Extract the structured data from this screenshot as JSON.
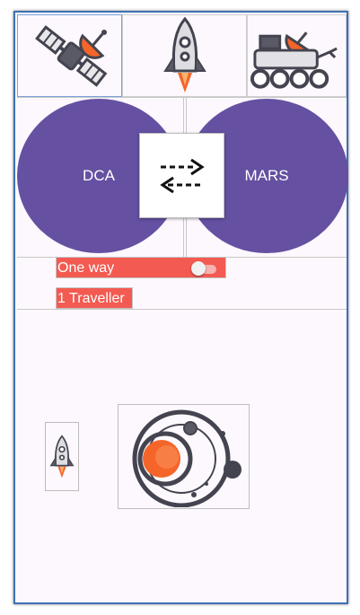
{
  "tabs": [
    {
      "name": "satellite",
      "icon": "satellite-icon",
      "selected": true
    },
    {
      "name": "rocket",
      "icon": "rocket-icon",
      "selected": false
    },
    {
      "name": "rover",
      "icon": "mars-rover-icon",
      "selected": false
    }
  ],
  "route": {
    "origin": "DCA",
    "destination": "MARS",
    "swap_icon": "swap-arrows-icon"
  },
  "trip_type": {
    "label": "One way",
    "toggle_on": false
  },
  "travellers": {
    "label": "1 Traveller"
  },
  "images": {
    "small": "rocket-icon",
    "large": "planet-orbit-icon"
  },
  "colors": {
    "accent": "#6550a2",
    "pill": "#f35a51",
    "icon_orange": "#f5652a",
    "icon_dark": "#444450",
    "frame_border": "#3f70b3"
  }
}
